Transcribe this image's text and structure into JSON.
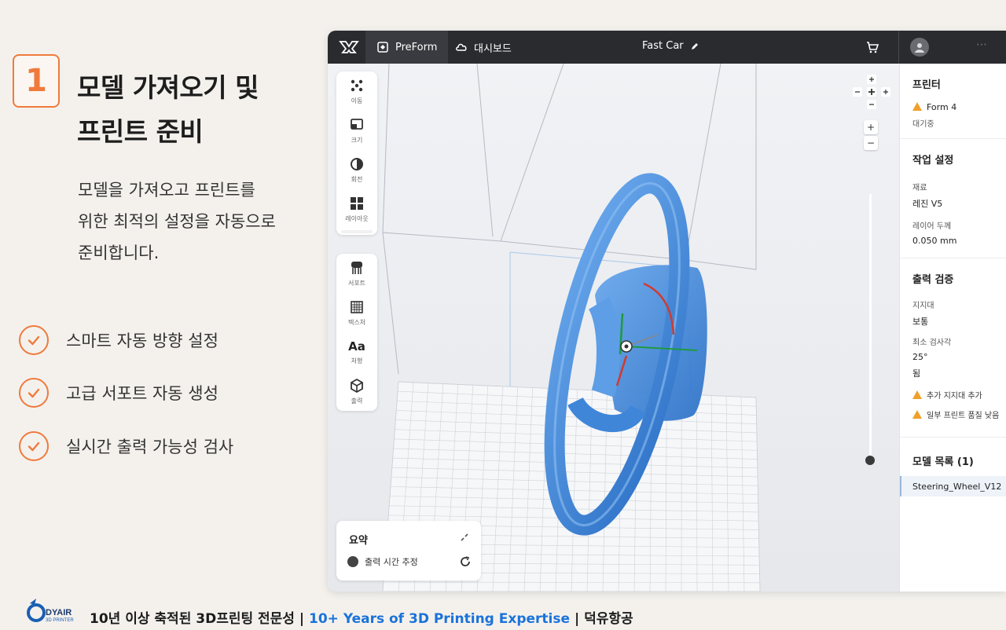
{
  "hero": {
    "step_number": "1",
    "title_line1": "모델 가져오기 및",
    "title_line2": "프린트 준비",
    "desc_line1": "모델을 가져오고 프린트를",
    "desc_line2": "위한 최적의 설정을 자동으로",
    "desc_line3": "준비합니다.",
    "features": [
      "스마트 자동 방향 설정",
      "고급 서포트 자동 생성",
      "실시간 출력 가능성 검사"
    ]
  },
  "app": {
    "tabs": [
      {
        "label": "PreForm",
        "icon": "preform-icon"
      },
      {
        "label": "대시보드",
        "icon": "cloud-icon"
      }
    ],
    "document_title": "Fast Car",
    "toolbar": [
      {
        "label": "이동",
        "icon": "move-icon"
      },
      {
        "label": "크기",
        "icon": "scale-icon"
      },
      {
        "label": "회전",
        "icon": "rotate-icon"
      },
      {
        "label": "레이아웃",
        "icon": "layout-icon"
      },
      {
        "label": "서포트",
        "icon": "supports-icon"
      },
      {
        "label": "텍스처",
        "icon": "texture-icon"
      },
      {
        "label": "처형",
        "icon": "text-icon"
      },
      {
        "label": "출력",
        "icon": "print-icon"
      }
    ],
    "summary": {
      "title": "요약",
      "estimate_label": "출력 시간 추정"
    },
    "right_panel": {
      "printer_heading": "프린터",
      "printer_name": "Form 4",
      "printer_status": "대기중",
      "job_heading": "작업 설정",
      "material_label": "재료",
      "material_value": "레진 V5",
      "layer_label": "레이어 두께",
      "layer_value": "0.050 mm",
      "check_heading": "출력 검증",
      "support_label": "지지대",
      "support_value": "보통",
      "angle_label": "최소 검사각",
      "angle_value": "25°",
      "extra_value": "됨",
      "warnings": [
        "추가 지지대 추가",
        "일부 프린트 품질 낮음"
      ],
      "models_heading": "모델 목록 (1)",
      "model_item": "Steering_Wheel_V12"
    },
    "colors": {
      "accent": "#f07a3c",
      "model": "#3f86d9",
      "warning": "#f0a02a",
      "topbar": "#2a2b2f"
    }
  },
  "footer": {
    "brand": "DYAIR",
    "brand_sub": "3D PRINTER",
    "text_ko": "10년 이상 축적된 3D프린팅 전문성 |",
    "text_en": "10+ Years of 3D Printing Expertise",
    "text_tail": "| 덕유항공"
  }
}
